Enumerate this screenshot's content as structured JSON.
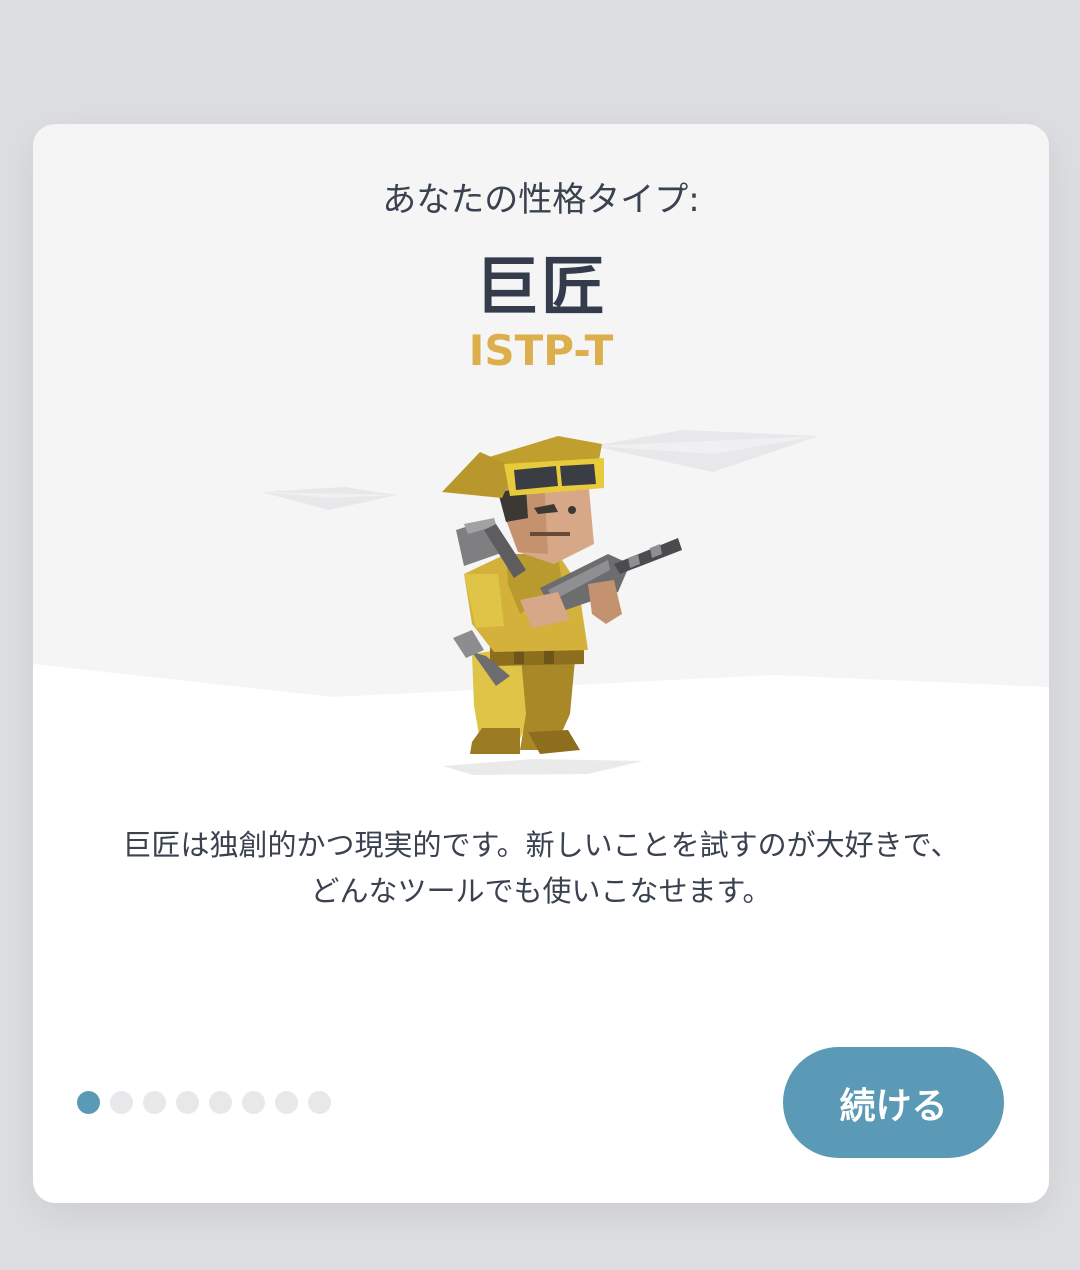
{
  "header": {
    "label": "あなたの性格タイプ:",
    "title": "巨匠",
    "code": "ISTP-T"
  },
  "illustration": {
    "icon": "virtuoso-craftsman-illustration"
  },
  "description": "巨匠は独創的かつ現実的です。新しいことを試すのが大好きで、どんなツールでも使いこなせます。",
  "pagination": {
    "total": 8,
    "current": 1
  },
  "actions": {
    "continue_label": "続ける"
  },
  "colors": {
    "accent": "#dcae4c",
    "button": "#5b9ab6",
    "dot_active": "#5b9ab6",
    "dot_inactive": "#e7e8ea",
    "text": "#3a4250"
  }
}
